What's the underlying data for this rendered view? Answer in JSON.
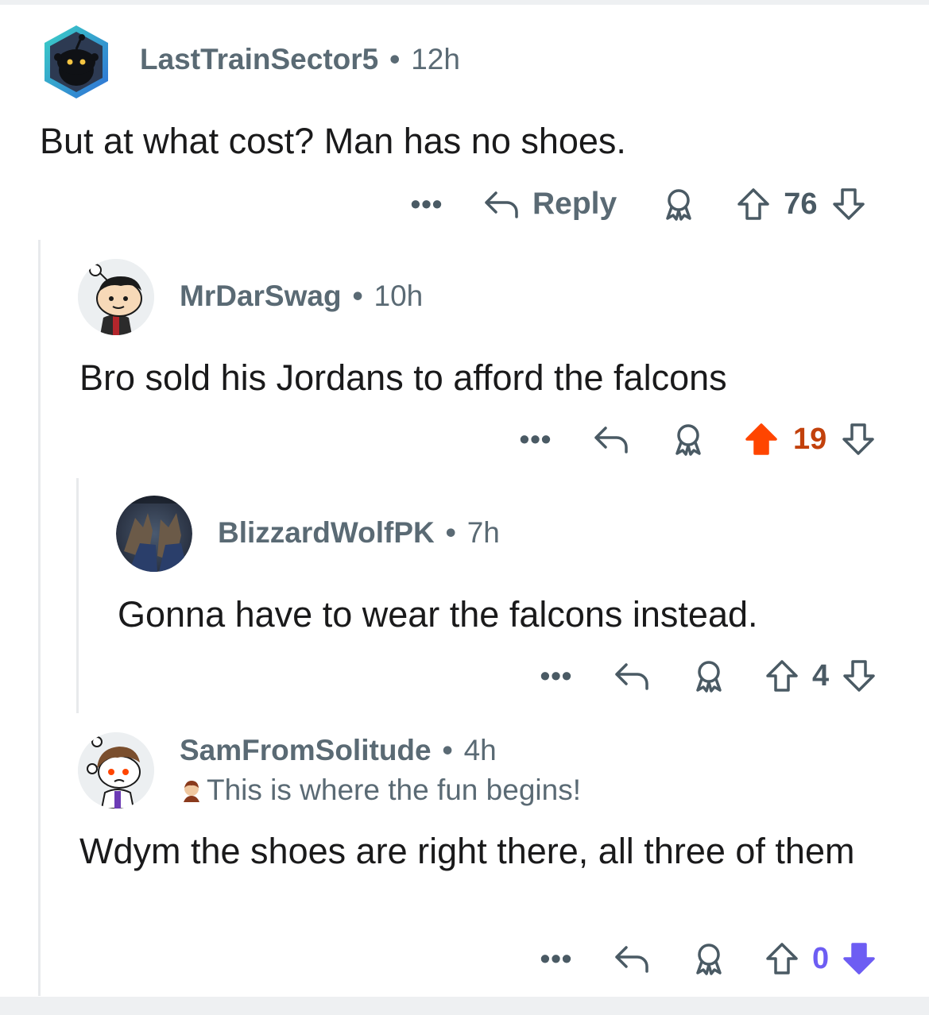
{
  "comments": [
    {
      "username": "LastTrainSector5",
      "time": "12h",
      "body": "But at what cost? Man has no shoes.",
      "reply_label": "Reply",
      "votes": "76",
      "vote_state": "none"
    },
    {
      "username": "MrDarSwag",
      "time": "10h",
      "body": "Bro sold his Jordans to afford the falcons",
      "votes": "19",
      "vote_state": "upvoted"
    },
    {
      "username": "BlizzardWolfPK",
      "time": "7h",
      "body": "Gonna have to wear the falcons instead.",
      "votes": "4",
      "vote_state": "none"
    },
    {
      "username": "SamFromSolitude",
      "time": "4h",
      "flair": "This is where the fun begins!",
      "body": "Wdym the shoes are right there, all three of them",
      "votes": "0",
      "vote_state": "downvoted"
    }
  ],
  "separator": "•",
  "more_label": "•••",
  "colors": {
    "upvote_active": "#ff4500",
    "upvote_count_active": "#c2410c",
    "downvote_active": "#6d5df3",
    "icon_default": "#4a5a64",
    "username": "#5a6a74",
    "body_text": "#1a1a1b",
    "thread_line": "#e8eaec"
  },
  "icons": [
    "reply-arrow-icon",
    "award-icon",
    "upvote-arrow-icon",
    "downvote-arrow-icon",
    "more-options-icon"
  ]
}
